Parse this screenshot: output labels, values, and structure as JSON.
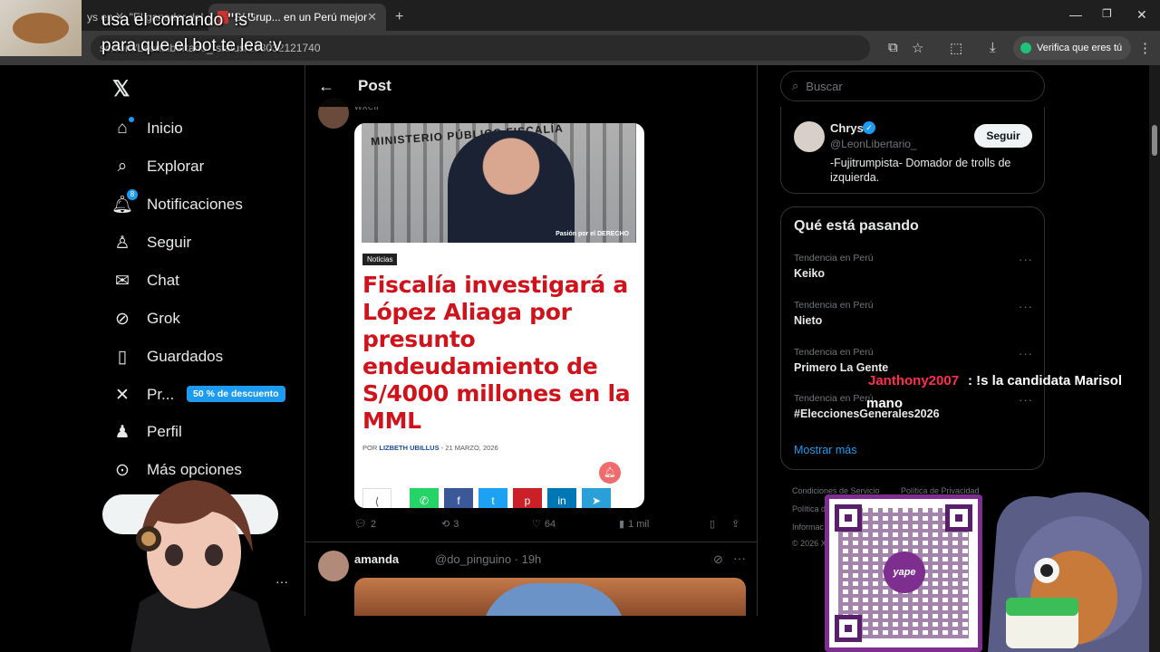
{
  "browser": {
    "tabs": [
      {
        "label": "ys en X: \"El ganador del..."
      },
      {
        "label": "S/ Grup... en un Perú mejor"
      }
    ],
    "new_tab_label": "+",
    "url": "sc.com/LeonLibertario_/status/193032121740",
    "verify_label": "Verifica que eres tú"
  },
  "overlay": {
    "caption_line1": "usa el comando \"!s\"",
    "caption_line2": "para que el bot te lea :v",
    "chat_user": "Janthony2007",
    "chat_message": ": !s la candidata Marisol",
    "chat_message_cont": "mano"
  },
  "nav": {
    "items": [
      {
        "label": "Inicio",
        "icon": "home-icon"
      },
      {
        "label": "Explorar",
        "icon": "search-icon"
      },
      {
        "label": "Notificaciones",
        "icon": "bell-icon",
        "badge": "8"
      },
      {
        "label": "Seguir",
        "icon": "add-person-icon"
      },
      {
        "label": "Chat",
        "icon": "mail-icon"
      },
      {
        "label": "Grok",
        "icon": "grok-icon"
      },
      {
        "label": "Guardados",
        "icon": "bookmark-icon"
      },
      {
        "label": "Pr...",
        "icon": "x-premium-icon"
      },
      {
        "label": "Perfil",
        "icon": "person-icon"
      },
      {
        "label": "Más opciones",
        "icon": "more-circle-icon"
      }
    ],
    "discount_badge": "50 % de descuento"
  },
  "post": {
    "header_title": "Post",
    "top_author": "wxell",
    "article": {
      "tag": "Noticias",
      "image_text": "MINISTERIO PÚBLICO FISCALÍA",
      "image_logo": "Pasión por el DERECHO",
      "headline": "Fiscalía investigará a López Aliaga por presunto endeudamiento de S/4000 millones en la MML",
      "byline_prefix": "POR",
      "byline_author": "LIZBETH UBILLUS",
      "byline_sep": " - ",
      "byline_date": "21 MARZO, 2026"
    },
    "actions": {
      "replies": "2",
      "reposts": "3",
      "likes": "64",
      "views": "1 mil"
    },
    "next_post": {
      "name": "amanda",
      "handle": "@do_pinguino · 19h"
    }
  },
  "sidebar": {
    "search_placeholder": "Buscar",
    "follow_card": {
      "name": "Chrys",
      "handle": "@LeonLibertario_",
      "bio": "-Fujitrumpista- Domador de trolls de izquierda.",
      "button": "Seguir"
    },
    "trends_title": "Qué está pasando",
    "trends": [
      {
        "context": "Tendencia en Perú",
        "name": "Keiko"
      },
      {
        "context": "Tendencia en Perú",
        "name": "Nieto"
      },
      {
        "context": "Tendencia en Perú",
        "name": "Primero La Gente"
      },
      {
        "context": "Tendencia en Perú",
        "name": "#EleccionesGenerales2026"
      }
    ],
    "show_more": "Mostrar más",
    "footer": [
      "Condiciones de Servicio",
      "Política de Privacidad",
      "Política d",
      "Informac",
      "© 2026 X"
    ]
  },
  "qr": {
    "brand": "yape"
  },
  "colors": {
    "accent": "#1d9bf0",
    "headline_red": "#d0121b",
    "yape_purple": "#7d2e8f",
    "chat_user": "#ff2e4d"
  }
}
